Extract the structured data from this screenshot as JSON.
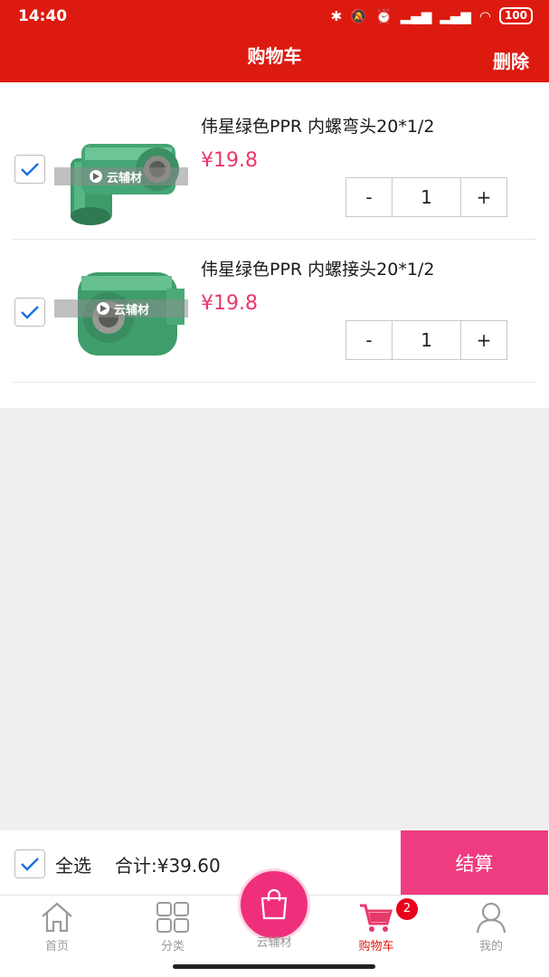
{
  "status": {
    "time": "14:40",
    "battery": "100"
  },
  "header": {
    "title": "购物车",
    "delete_label": "删除"
  },
  "cart": {
    "items": [
      {
        "title": "伟星绿色PPR 内螺弯头20*1/2",
        "price": "¥19.8",
        "qty": "1",
        "minus": "-",
        "plus": "+",
        "checked": true,
        "watermark": "云辅材"
      },
      {
        "title": "伟星绿色PPR 内螺接头20*1/2",
        "price": "¥19.8",
        "qty": "1",
        "minus": "-",
        "plus": "+",
        "checked": true,
        "watermark": "云辅材"
      }
    ]
  },
  "checkout": {
    "select_all_label": "全选",
    "total_label": "合计:¥39.60",
    "button_label": "结算"
  },
  "tabbar": {
    "items": [
      {
        "label": "首页",
        "icon": "home-icon"
      },
      {
        "label": "分类",
        "icon": "grid-icon"
      },
      {
        "label": "云辅材",
        "icon": "shopping-bag-icon"
      },
      {
        "label": "购物车",
        "icon": "cart-icon",
        "badge": "2",
        "active": true
      },
      {
        "label": "我的",
        "icon": "user-icon"
      }
    ]
  },
  "colors": {
    "brand_red": "#dd1a10",
    "price_pink": "#e8386b",
    "checkout_pink": "#ef3c80",
    "check_blue": "#1f6fe0"
  }
}
